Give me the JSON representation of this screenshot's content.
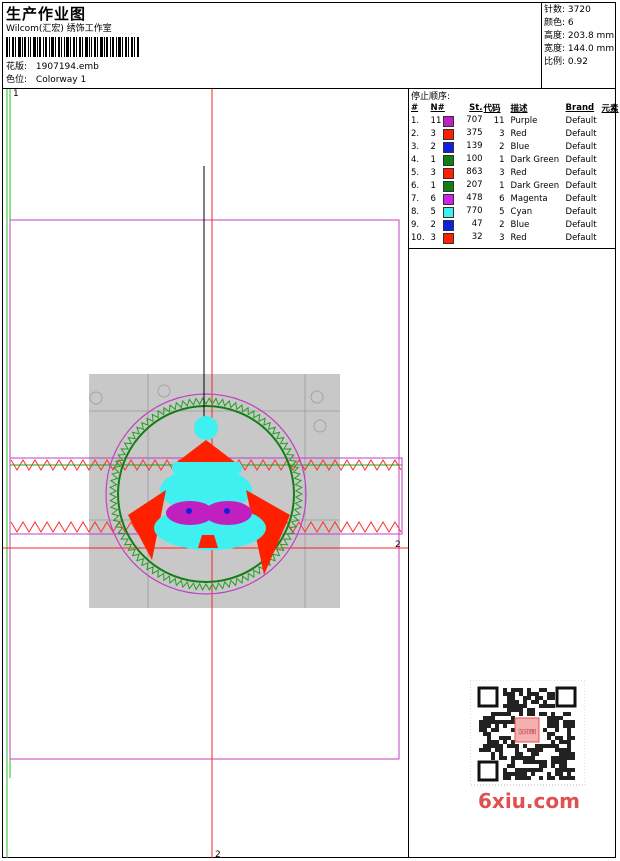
{
  "header": {
    "title": "生产作业图",
    "company": "Wilcom(汇宏) 绣饰工作室",
    "design_label": "花版:",
    "design_value": "1907194.emb",
    "colorway_label": "色位:",
    "colorway_value": "Colorway 1"
  },
  "stats": [
    {
      "label": "针数:",
      "value": "3720"
    },
    {
      "label": "颜色:",
      "value": "6"
    },
    {
      "label": "高度:",
      "value": "203.8 mm"
    },
    {
      "label": "宽度:",
      "value": "144.0 mm"
    },
    {
      "label": "比例:",
      "value": "0.92"
    }
  ],
  "sequence": {
    "title": "停止顺序:",
    "headers": [
      "#",
      "N#",
      "St.",
      "代码",
      "描述",
      "Brand",
      "元素"
    ],
    "rows": [
      {
        "idx": "1.",
        "n": "11",
        "color": "#c020c0",
        "st": "707",
        "code": "11",
        "desc": "Purple",
        "brand": "Default"
      },
      {
        "idx": "2.",
        "n": "3",
        "color": "#ff2000",
        "st": "375",
        "code": "3",
        "desc": "Red",
        "brand": "Default"
      },
      {
        "idx": "3.",
        "n": "2",
        "color": "#1020e0",
        "st": "139",
        "code": "2",
        "desc": "Blue",
        "brand": "Default"
      },
      {
        "idx": "4.",
        "n": "1",
        "color": "#108010",
        "st": "100",
        "code": "1",
        "desc": "Dark Green",
        "brand": "Default"
      },
      {
        "idx": "5.",
        "n": "3",
        "color": "#ff2000",
        "st": "863",
        "code": "3",
        "desc": "Red",
        "brand": "Default"
      },
      {
        "idx": "6.",
        "n": "1",
        "color": "#108010",
        "st": "207",
        "code": "1",
        "desc": "Dark Green",
        "brand": "Default"
      },
      {
        "idx": "7.",
        "n": "6",
        "color": "#d020f0",
        "st": "478",
        "code": "6",
        "desc": "Magenta",
        "brand": "Default"
      },
      {
        "idx": "8.",
        "n": "5",
        "color": "#40f0f0",
        "st": "770",
        "code": "5",
        "desc": "Cyan",
        "brand": "Default"
      },
      {
        "idx": "9.",
        "n": "2",
        "color": "#1020e0",
        "st": "47",
        "code": "2",
        "desc": "Blue",
        "brand": "Default"
      },
      {
        "idx": "10.",
        "n": "3",
        "color": "#ff2000",
        "st": "32",
        "code": "3",
        "desc": "Red",
        "brand": "Default"
      }
    ]
  },
  "canvas": {
    "marker_top": "1",
    "marker_right": "2",
    "marker_bottom": "2"
  },
  "watermark": {
    "text": "6xiu.com",
    "stamp_text": "汉印图"
  },
  "colors": {
    "guide_red": "#ff2020",
    "guide_magenta": "#c040c0",
    "guide_green": "#20c020",
    "zigzag": "#ff3030",
    "ring_green": "#20a020",
    "watermark": "#e05050"
  }
}
